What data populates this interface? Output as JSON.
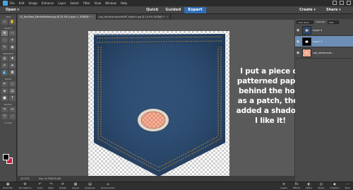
{
  "menubar": {
    "items": [
      "File",
      "Edit",
      "Image",
      "Enhance",
      "Layer",
      "Select",
      "Filter",
      "View",
      "Window",
      "Help"
    ]
  },
  "modebar": {
    "open_label": "Open",
    "tabs": [
      "Quick",
      "Guided",
      "Expert"
    ],
    "active_tab": "Expert",
    "create_label": "Create",
    "share_label": "Share"
  },
  "toolbox": {
    "sections": [
      "VIEW",
      "SELECT",
      "ENHANCE",
      "DRAW",
      "MODIFY",
      "COLOR"
    ],
    "fg_color": "#000000",
    "bg_color": "#d21c3a"
  },
  "document": {
    "tabs": [
      {
        "label": "LS_YouShed_DenimPocket.png @ 33.3% (Layer 1, RGB/8) *"
      },
      {
        "label": "cap_denimandpocket9P_swatch.jpg @ 14.9% (RGB/8) *"
      }
    ],
    "status_zoom": "33.33%",
    "status_doc": "Doc: 6.75M/13.4M",
    "annotation": "I put a piece of patterned paper behind the hole as a patch, then added a shadow. I like it!"
  },
  "layers_panel": {
    "blend_mode": "Color Burn",
    "opacity_label": "Opacity:",
    "opacity_value": "94%",
    "layers": [
      {
        "name": "Layer 4"
      },
      {
        "name": "Layer 1"
      },
      {
        "name": "cap_denimand..."
      }
    ]
  },
  "taskbar": {
    "left": [
      {
        "label": "Photo Bin",
        "icon": "photo-bin-icon",
        "glyph": "▣"
      },
      {
        "label": "Tool Options",
        "icon": "tool-options-icon",
        "glyph": "⚙"
      },
      {
        "label": "Undo",
        "icon": "undo-icon",
        "glyph": "↶"
      },
      {
        "label": "Redo",
        "icon": "redo-icon",
        "glyph": "↷"
      },
      {
        "label": "Rotate",
        "icon": "rotate-icon",
        "glyph": "⟳"
      },
      {
        "label": "Layout",
        "icon": "layout-icon",
        "glyph": "▦"
      },
      {
        "label": "Organizer",
        "icon": "organizer-icon",
        "glyph": "▤"
      },
      {
        "label": "Home Screen",
        "icon": "home-icon",
        "glyph": "⌂"
      }
    ],
    "right": [
      {
        "label": "Layers",
        "icon": "layers-icon",
        "glyph": "≡"
      },
      {
        "label": "Effects",
        "icon": "effects-icon",
        "glyph": "fx"
      },
      {
        "label": "Filters",
        "icon": "filters-icon",
        "glyph": "◐"
      },
      {
        "label": "Styles",
        "icon": "styles-icon",
        "glyph": "◎"
      },
      {
        "label": "Graphics",
        "icon": "graphics-icon",
        "glyph": "◆"
      },
      {
        "label": "More",
        "icon": "more-icon",
        "glyph": "⋯"
      }
    ]
  }
}
